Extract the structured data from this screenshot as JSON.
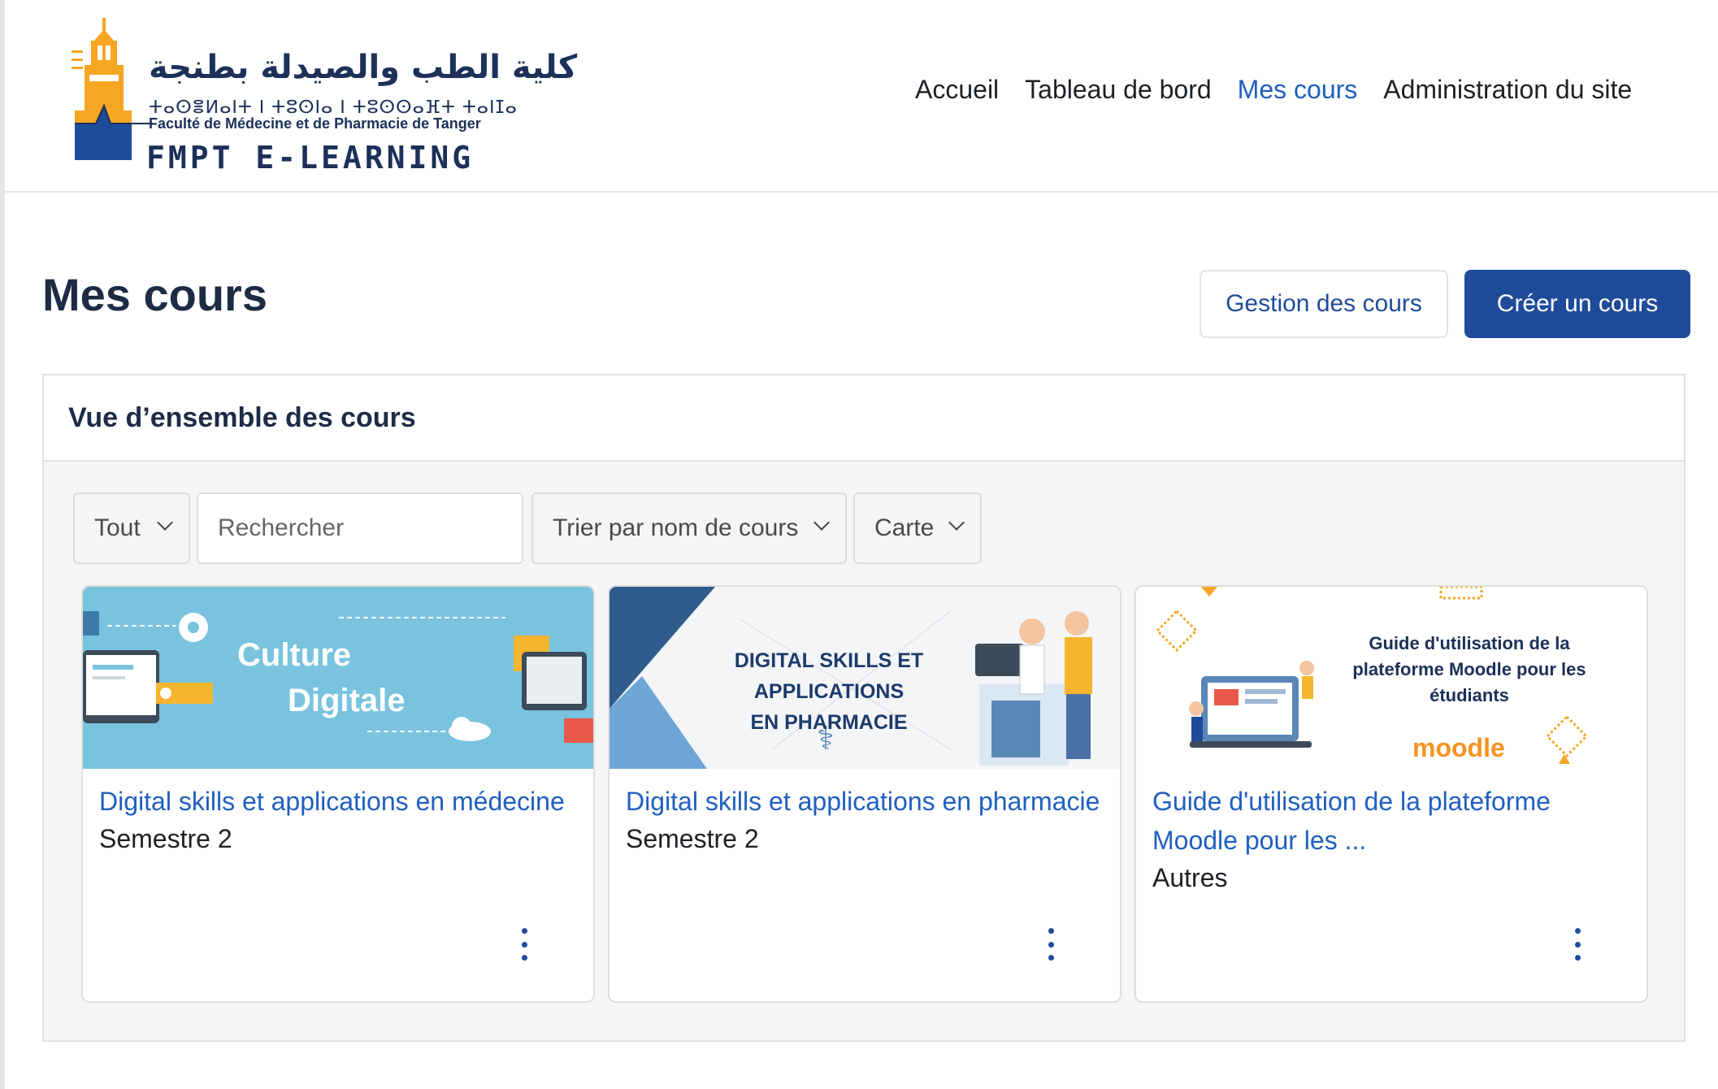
{
  "header": {
    "logo": {
      "arabic": "كلية الطب والصيدلة بطنجة",
      "tifinagh": "ⵜⴰⵙⴻⵍⴰⵏⵜ ⵏ ⵜⵓⵙⵏⴰ ⵏ ⵜⵓⵙⵙⴰⴼⵜ ⵜⴰⵏⵊⴰ",
      "faculty": "Faculté de Médecine et de Pharmacie de Tanger",
      "brand": "FMPT  E-LEARNING"
    },
    "nav": [
      {
        "label": "Accueil",
        "active": false
      },
      {
        "label": "Tableau de bord",
        "active": false
      },
      {
        "label": "Mes cours",
        "active": true
      },
      {
        "label": "Administration du site",
        "active": false
      }
    ]
  },
  "page": {
    "title": "Mes cours",
    "manage_button": "Gestion des cours",
    "create_button": "Créer un cours"
  },
  "overview": {
    "title": "Vue d’ensemble des cours",
    "filters": {
      "grouping": "Tout",
      "search_placeholder": "Rechercher",
      "sort": "Trier par nom de cours",
      "view": "Carte"
    },
    "courses": [
      {
        "title": "Digital skills et applications en médecine",
        "category": "Semestre 2",
        "image_text": [
          "Culture",
          "Digitale"
        ]
      },
      {
        "title": "Digital skills et applications en pharmacie",
        "category": "Semestre 2",
        "image_text": [
          "DIGITAL SKILLS ET APPLICATIONS",
          "EN PHARMACIE"
        ]
      },
      {
        "title": "Guide d'utilisation de la plateforme Moodle pour les ...",
        "category": "Autres",
        "image_text": [
          "Guide d'utilisation de la plateforme Moodle pour les étudiants",
          "moodle"
        ]
      }
    ]
  },
  "colors": {
    "primary": "#1f4c9a",
    "link": "#1f5fbf",
    "title": "#1d2b45",
    "logo_orange": "#f5a623"
  }
}
